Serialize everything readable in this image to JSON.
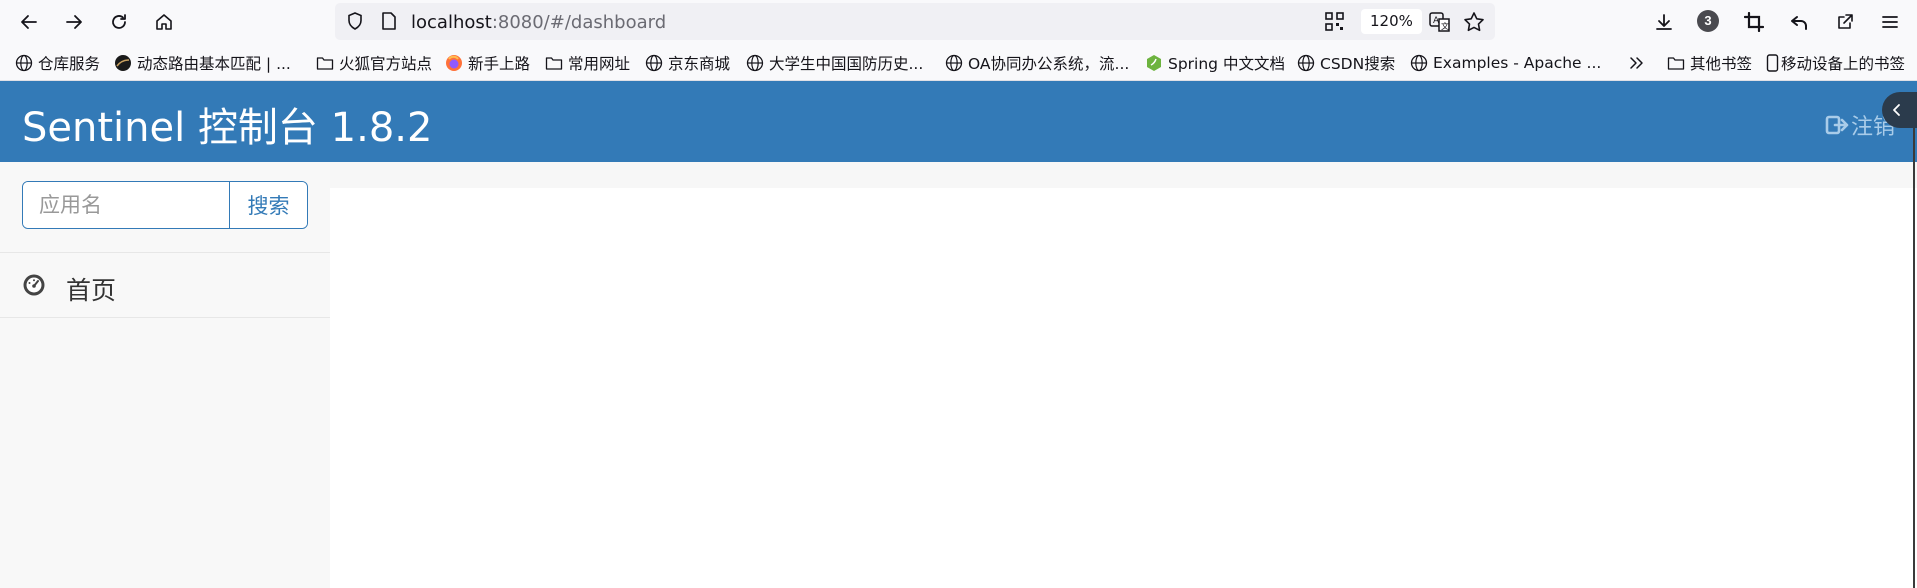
{
  "browser": {
    "url_host": "localhost",
    "url_rest": ":8080/#/dashboard",
    "zoom": "120%",
    "downloads_badge": "3",
    "icons": [
      "back-icon",
      "forward-icon",
      "reload-icon",
      "home-icon",
      "shield-icon",
      "page-icon",
      "qr-code-icon",
      "translate-icon",
      "star-icon",
      "download-icon",
      "extensions-badge",
      "crop-icon",
      "undo-icon",
      "share-icon",
      "menu-icon"
    ]
  },
  "bookmarks": [
    {
      "label": "仓库服务",
      "icon": "globe"
    },
    {
      "label": "动态路由基本匹配 | ...",
      "icon": "site"
    },
    {
      "label": "火狐官方站点",
      "icon": "folder"
    },
    {
      "label": "新手上路",
      "icon": "firefox"
    },
    {
      "label": "常用网址",
      "icon": "folder"
    },
    {
      "label": "京东商城",
      "icon": "globe"
    },
    {
      "label": "大学生中国国防历史...",
      "icon": "globe"
    },
    {
      "label": "OA协同办公系统，流...",
      "icon": "globe"
    },
    {
      "label": "Spring 中文文档",
      "icon": "spring"
    },
    {
      "label": "CSDN搜索",
      "icon": "globe"
    },
    {
      "label": "Examples - Apache ...",
      "icon": "globe"
    }
  ],
  "bookmarks_right": {
    "other": "其他书签",
    "mobile": "移动设备上的书签"
  },
  "app": {
    "title": "Sentinel 控制台 1.8.2",
    "logout": "注销",
    "search_placeholder": "应用名",
    "search_button": "搜索",
    "nav": [
      {
        "label": "首页",
        "icon": "dashboard-icon"
      }
    ],
    "colors": {
      "header": "#337ab7",
      "sidebar": "#f8f8f8",
      "logout_text": "#a9cce9"
    }
  }
}
